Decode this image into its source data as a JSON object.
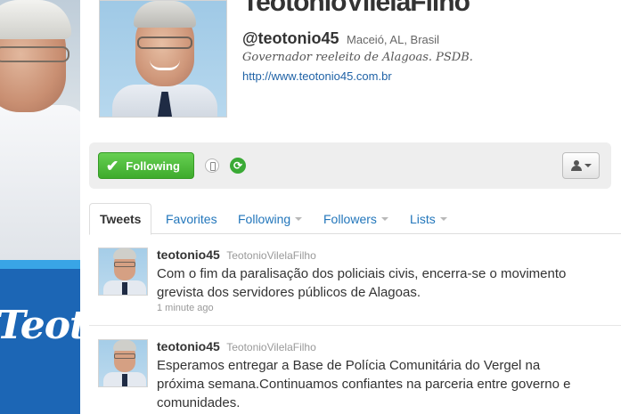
{
  "banner": {
    "logo_text": "Teotonio"
  },
  "profile": {
    "name": "TeotonioVilelaFilho",
    "handle": "@teotonio45",
    "location": "Maceió, AL, Brasil",
    "bio": "Governador reeleito de Alagoas. PSDB.",
    "url": "http://www.teotonio45.com.br"
  },
  "actions": {
    "follow_label": "Following",
    "icons": [
      "check-icon",
      "device-icon",
      "retweet-icon",
      "person-icon",
      "caret-down-icon"
    ]
  },
  "tabs": [
    {
      "label": "Tweets",
      "active": true
    },
    {
      "label": "Favorites",
      "active": false
    },
    {
      "label": "Following",
      "active": false,
      "dropdown": true
    },
    {
      "label": "Followers",
      "active": false,
      "dropdown": true
    },
    {
      "label": "Lists",
      "active": false,
      "dropdown": true
    }
  ],
  "tweets": [
    {
      "username": "teotonio45",
      "display_name": "TeotonioVilelaFilho",
      "text": "Com o fim da paralisação dos policiais civis, encerra-se o movimento grevista dos servidores públicos de Alagoas.",
      "time": "1 minute ago"
    },
    {
      "username": "teotonio45",
      "display_name": "TeotonioVilelaFilho",
      "text": "Esperamos entregar a Base de Polícia Comunitária do Vergel na próxima semana.Continuamos confiantes na parceria entre governo e comunidades."
    }
  ],
  "colors": {
    "follow_green": "#3eab2c",
    "link_blue": "#2276bb",
    "banner_blue": "#1c66b5",
    "text_dark": "#333333"
  }
}
